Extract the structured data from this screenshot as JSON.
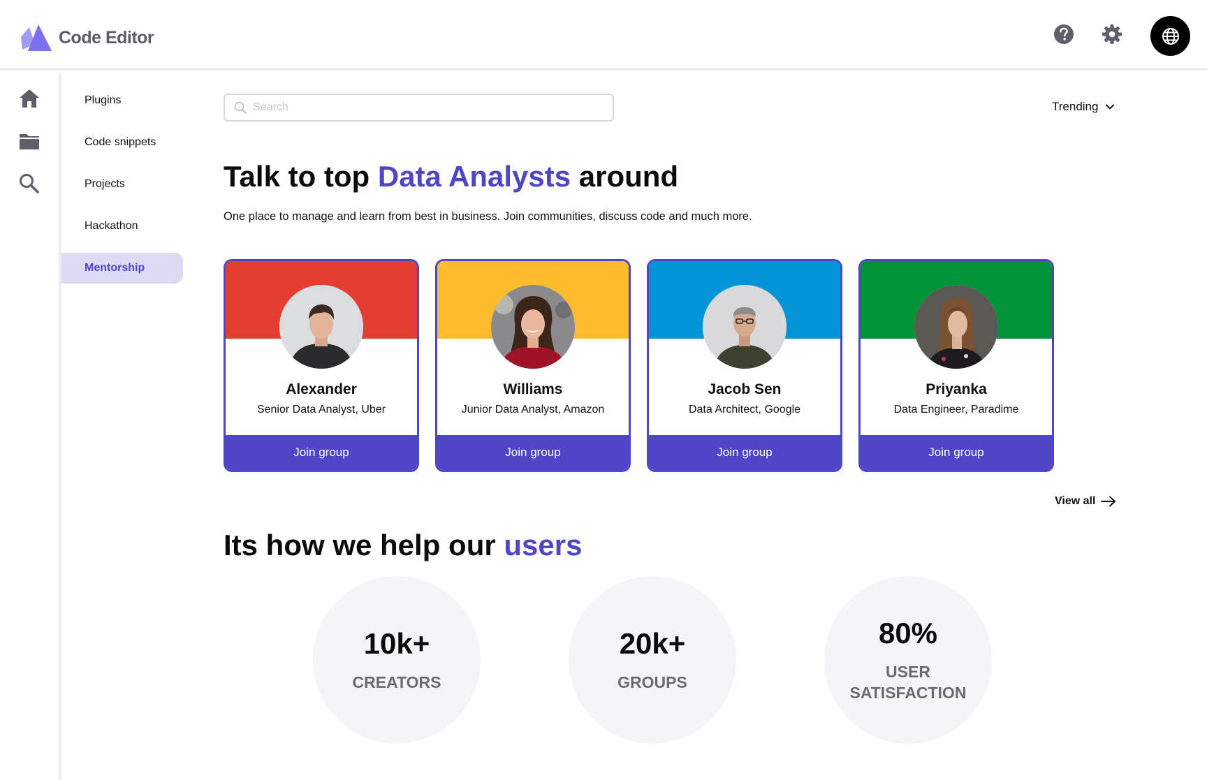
{
  "app": {
    "title": "Code Editor"
  },
  "colors": {
    "accent": "#4f46c7",
    "card_red": "#e43e32",
    "card_yellow": "#fdbb2d",
    "card_blue": "#0394d8",
    "card_green": "#01933a"
  },
  "header": {
    "help_icon": "help-circle-icon",
    "settings_icon": "gear-icon",
    "language_icon": "globe-icon"
  },
  "rail": {
    "items": [
      {
        "icon": "home-icon"
      },
      {
        "icon": "folder-icon"
      },
      {
        "icon": "search-icon"
      }
    ]
  },
  "sidebar": {
    "items": [
      {
        "label": "Plugins",
        "active": false
      },
      {
        "label": "Code snippets",
        "active": false
      },
      {
        "label": "Projects",
        "active": false
      },
      {
        "label": "Hackathon",
        "active": false
      },
      {
        "label": "Mentorship",
        "active": true
      }
    ]
  },
  "search": {
    "placeholder": "Search",
    "value": ""
  },
  "sort": {
    "selected": "Trending"
  },
  "hero": {
    "title_before": "Talk to top ",
    "title_accent": "Data Analysts",
    "title_after": " around",
    "subtitle": "One place to manage and learn from best in business. Join communities, discuss code and much more."
  },
  "mentors": [
    {
      "name": "Alexander",
      "role": "Senior Data Analyst, Uber",
      "cta": "Join group",
      "band_color": "#e43e32"
    },
    {
      "name": "Williams",
      "role": "Junior Data Analyst, Amazon",
      "cta": "Join group",
      "band_color": "#fdbb2d"
    },
    {
      "name": "Jacob Sen",
      "role": "Data Architect, Google",
      "cta": "Join group",
      "band_color": "#0394d8"
    },
    {
      "name": "Priyanka",
      "role": "Data Engineer, Paradime",
      "cta": "Join group",
      "band_color": "#01933a"
    }
  ],
  "view_all": {
    "label": "View all"
  },
  "help_section": {
    "title_before": "Its how we help our ",
    "title_accent": "users"
  },
  "stats": [
    {
      "value": "10k+",
      "label": "CREATORS"
    },
    {
      "value": "20k+",
      "label": "GROUPS"
    },
    {
      "value": "80%",
      "label": "USER SATISFACTION"
    }
  ]
}
